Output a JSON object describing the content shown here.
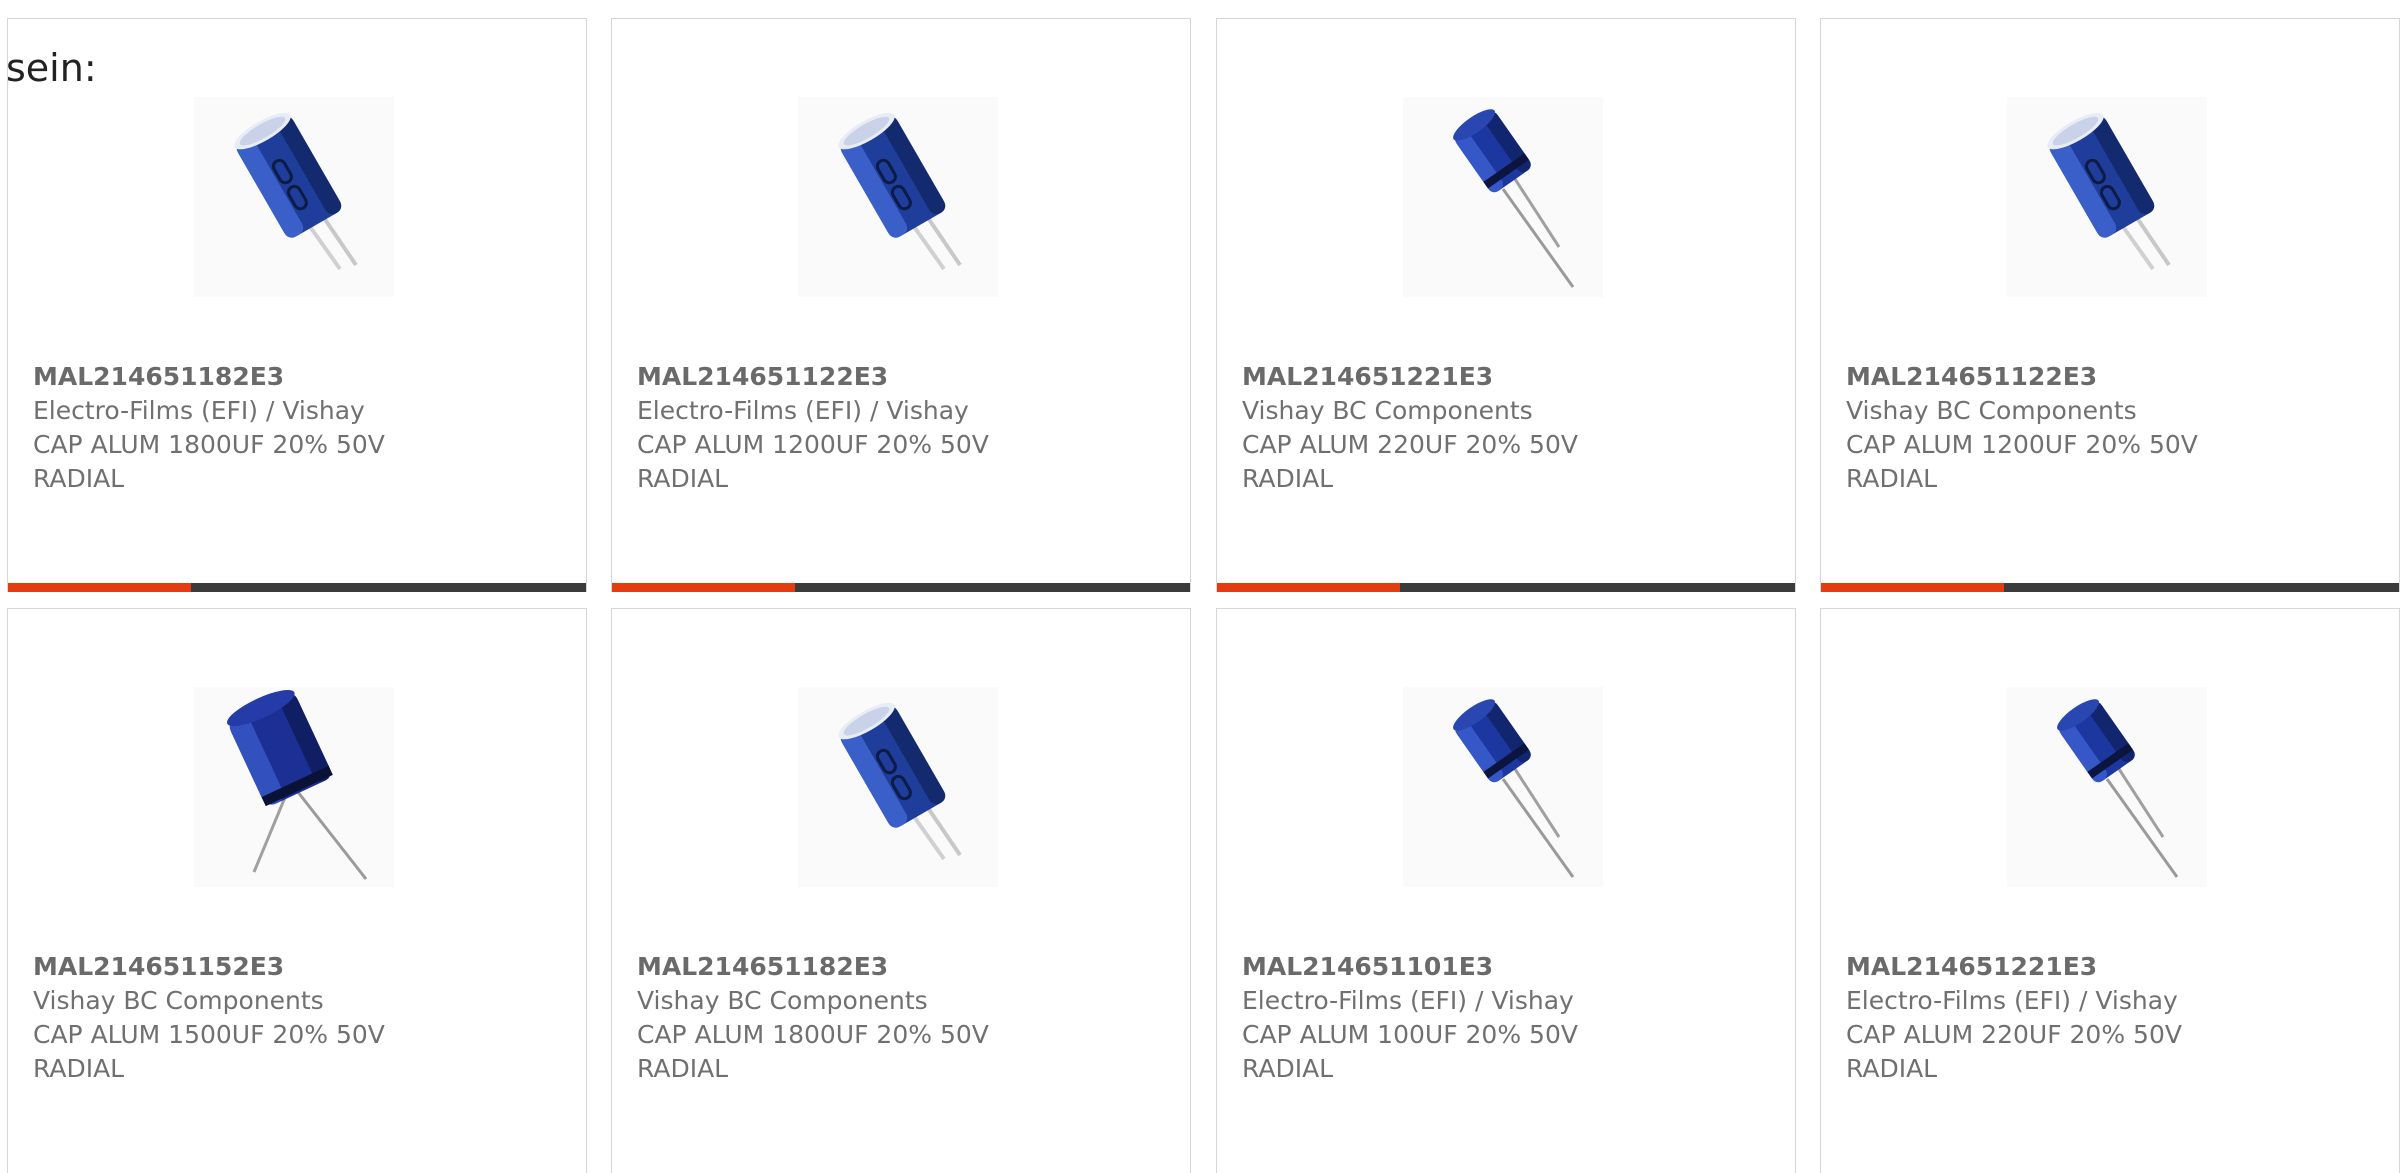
{
  "intro_text": "sein:",
  "accent_color": "#e43b11",
  "bar_color": "#3b3b3b",
  "products": [
    {
      "part_number": "MAL214651182E3",
      "manufacturer": "Electro-Films (EFI) / Vishay",
      "desc_line1": "CAP ALUM 1800UF 20% 50V",
      "desc_line2": "RADIAL",
      "image": "capacitor-large"
    },
    {
      "part_number": "MAL214651122E3",
      "manufacturer": "Electro-Films (EFI) / Vishay",
      "desc_line1": "CAP ALUM 1200UF 20% 50V",
      "desc_line2": "RADIAL",
      "image": "capacitor-large"
    },
    {
      "part_number": "MAL214651221E3",
      "manufacturer": "Vishay BC Components",
      "desc_line1": "CAP ALUM 220UF 20% 50V",
      "desc_line2": "RADIAL",
      "image": "capacitor-small"
    },
    {
      "part_number": "MAL214651122E3",
      "manufacturer": "Vishay BC Components",
      "desc_line1": "CAP ALUM 1200UF 20% 50V",
      "desc_line2": "RADIAL",
      "image": "capacitor-large"
    },
    {
      "part_number": "MAL214651152E3",
      "manufacturer": "Vishay BC Components",
      "desc_line1": "CAP ALUM 1500UF 20% 50V",
      "desc_line2": "RADIAL",
      "image": "capacitor-medium"
    },
    {
      "part_number": "MAL214651182E3",
      "manufacturer": "Vishay BC Components",
      "desc_line1": "CAP ALUM 1800UF 20% 50V",
      "desc_line2": "RADIAL",
      "image": "capacitor-large"
    },
    {
      "part_number": "MAL214651101E3",
      "manufacturer": "Electro-Films (EFI) / Vishay",
      "desc_line1": "CAP ALUM 100UF 20% 50V",
      "desc_line2": "RADIAL",
      "image": "capacitor-small"
    },
    {
      "part_number": "MAL214651221E3",
      "manufacturer": "Electro-Films (EFI) / Vishay",
      "desc_line1": "CAP ALUM 220UF 20% 50V",
      "desc_line2": "RADIAL",
      "image": "capacitor-small"
    }
  ]
}
